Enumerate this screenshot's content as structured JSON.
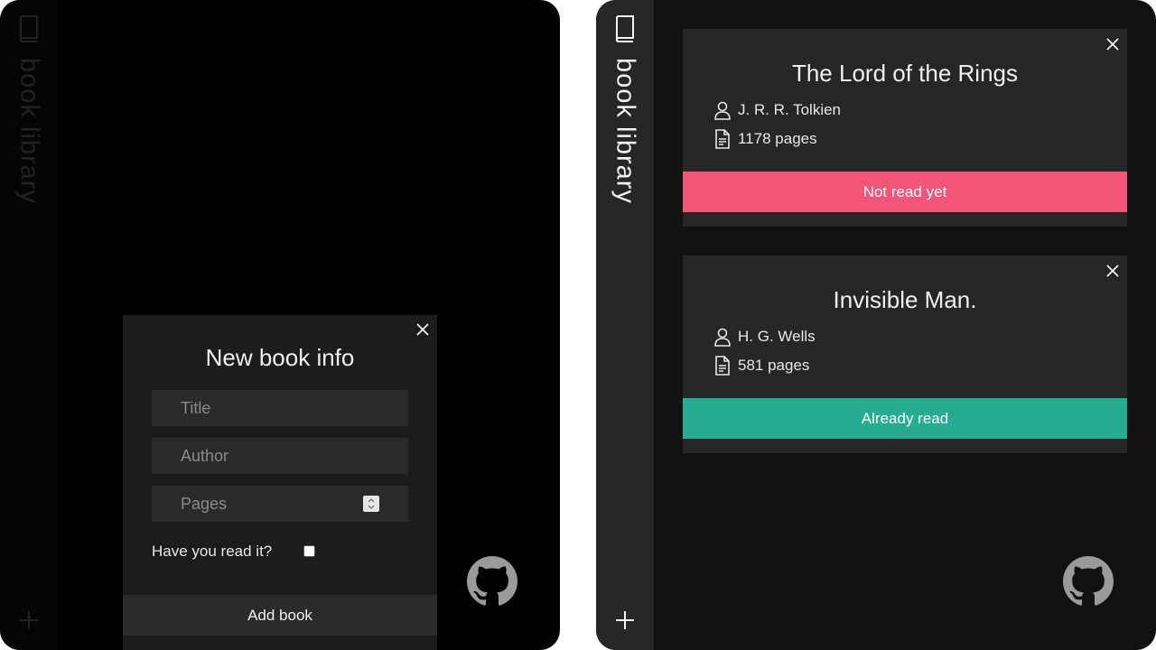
{
  "brand": "book library",
  "dialog": {
    "title": "New book info",
    "title_placeholder": "Title",
    "author_placeholder": "Author",
    "pages_placeholder": "Pages",
    "read_label": "Have you read it?",
    "read_checked": false,
    "submit_label": "Add book"
  },
  "books": [
    {
      "title": "The Lord of the Rings",
      "author": "J. R. R. Tolkien",
      "pages": "1178 pages",
      "status": "Not read yet",
      "status_color": "#f25577"
    },
    {
      "title": "Invisible Man.",
      "author": "H. G. Wells",
      "pages": "581 pages",
      "status": "Already read",
      "status_color": "#26ac91"
    }
  ],
  "colors": {
    "unread": "#f25577",
    "read": "#26ac91"
  }
}
